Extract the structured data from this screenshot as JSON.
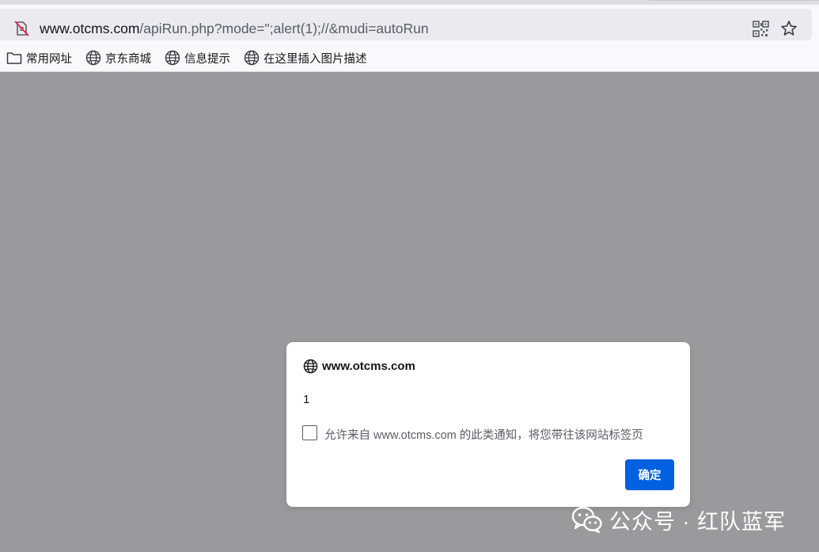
{
  "url_bar": {
    "url_host": "www.otcms.com",
    "url_path": "/apiRun.php?mode=\";alert(1);//&mudi=autoRun"
  },
  "bookmarks": [
    {
      "label": "常用网址",
      "icon": "folder-icon"
    },
    {
      "label": "京东商城",
      "icon": "globe-icon"
    },
    {
      "label": "信息提示",
      "icon": "globe-icon"
    },
    {
      "label": "在这里插入图片描述",
      "icon": "globe-icon"
    }
  ],
  "dialog": {
    "host": "www.otcms.com",
    "message": "1",
    "checkbox_label": "允许来自 www.otcms.com 的此类通知，将您带往该网站标签页",
    "checkbox_checked": false,
    "ok_label": "确定"
  },
  "watermark": {
    "text": "公众号 · 红队蓝军",
    "icon": "wechat-icon"
  },
  "colors": {
    "overlay": "#9a9a9c",
    "accent": "#0061e0",
    "toolbar": "#f9f9fb",
    "url_bar": "#ebebef"
  }
}
